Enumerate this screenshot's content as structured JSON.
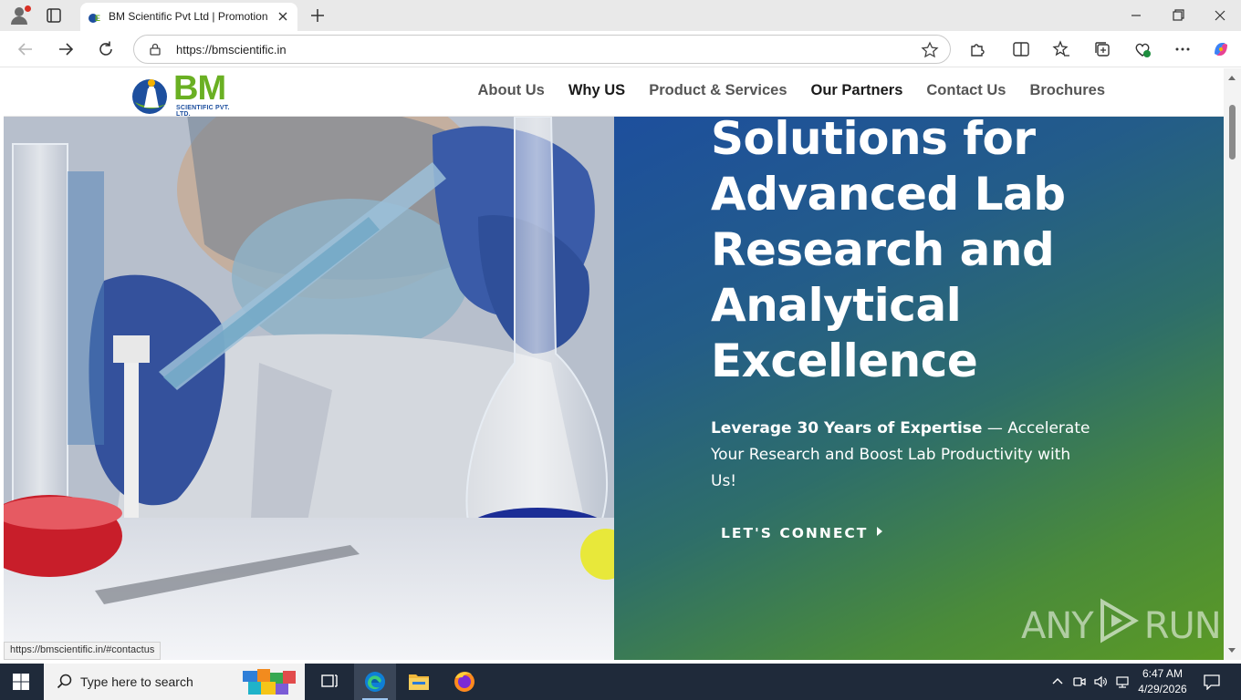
{
  "browser": {
    "tab_title": "BM Scientific Pvt Ltd | Promotion",
    "url": "https://bmscientific.in",
    "status_url": "https://bmscientific.in/#contactus"
  },
  "site": {
    "logo_text": "BM",
    "logo_subtext": "SCIENTIFIC PVT. LTD.",
    "nav": {
      "about": "About Us",
      "why": "Why US",
      "products": "Product & Services",
      "partners": "Our Partners",
      "contact": "Contact Us",
      "brochures": "Brochures"
    },
    "hero": {
      "title_lines": [
        "Solutions for",
        "Advanced Lab",
        "Research and",
        "Analytical",
        "Excellence"
      ],
      "sub_bold": "Leverage 30 Years of Expertise",
      "sub_rest": " — Accelerate Your Research and Boost Lab Productivity with Us!",
      "cta": "LET'S CONNECT"
    },
    "watermark_left": "ANY",
    "watermark_right": "RUN"
  },
  "taskbar": {
    "search_placeholder": "Type here to search",
    "time": "6:47 AM",
    "date": "4/29/2026"
  },
  "colors": {
    "brand_green": "#6ab023",
    "brand_blue": "#1d4f9e",
    "hero_gradient_start": "#1d4f9d",
    "hero_gradient_end": "#5b9a25"
  }
}
